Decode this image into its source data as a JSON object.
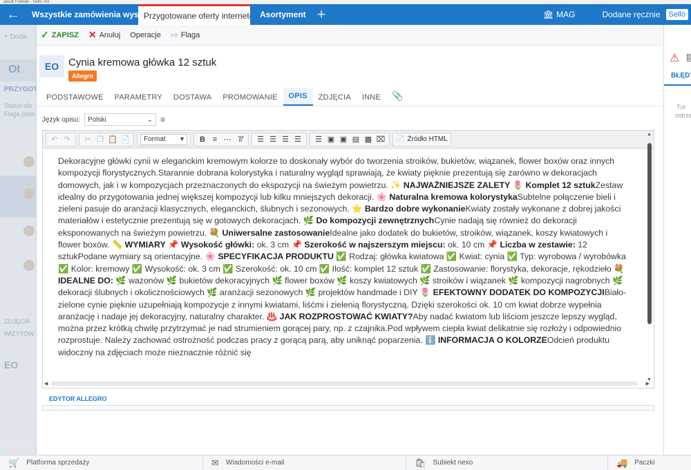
{
  "window": {
    "title": "Jakub Fulwiak - Sello Tex"
  },
  "topbar": {
    "tabs": [
      {
        "label": "Wszystkie zamówienia wysyłk"
      },
      {
        "label": "Przygotowane oferty internetowe"
      },
      {
        "label": "Asortyment"
      }
    ],
    "mag_label": "MAG",
    "user_label": "Dodane ręcznie",
    "sello_badge": "Sello"
  },
  "background_list": {
    "add_label": "Doda",
    "oi_label": "OI",
    "section_label": "PRZYGOT",
    "status_label": "Status ofe",
    "flag_label": "Flaga (dow",
    "zdjecia_label": "ZDJĘCIA",
    "wzytowe_label": "WIZYTÓW",
    "eo_label": "EO"
  },
  "toolbar": {
    "save_label": "ZAPISZ",
    "cancel_label": "Anuluj",
    "operations_label": "Operacje",
    "flag_label": "Flaga"
  },
  "product": {
    "avatar": "EO",
    "title": "Cynia kremowa główka 12 sztuk",
    "badge": "Allegro"
  },
  "nav_tabs": [
    {
      "label": "PODSTAWOWE"
    },
    {
      "label": "PARAMETRY"
    },
    {
      "label": "DOSTAWA"
    },
    {
      "label": "PROMOWANIE"
    },
    {
      "label": "OPIS"
    },
    {
      "label": "ZDJĘCIA"
    },
    {
      "label": "INNE"
    }
  ],
  "lang": {
    "label": "Język opisu:",
    "value": "Polski"
  },
  "rte": {
    "format_label": "Format",
    "source_label": "Źródło HTML",
    "editor_label": "EDYTOR ALLEGRO"
  },
  "description": {
    "p1": "Dekoracyjne główki cynii w eleganckim kremowym kolorze to doskonały wybór do tworzenia stroików, bukietów, wiązanek, flower boxów oraz innych kompozycji florystycznych.Starannie dobrana kolorystyka i naturalny wygląd sprawiają, że kwiaty pięknie prezentują się zarówno w dekoracjach domowych, jak i w kompozycjach przeznaczonych do ekspozycji na świeżym powietrzu.",
    "h_zalety": "NAJWAŻNIEJSZE ZALETY",
    "h_komplet": "Komplet 12 sztuk",
    "t_komplet": "Zestaw idealny do przygotowania jednej większej kompozycji lub kilku mniejszych dekoracji.",
    "h_naturalna": "Naturalna kremowa kolorystyka",
    "t_naturalna": "Subtelne połączenie bieli i zieleni pasuje do aranżacji klasycznych, eleganckich, ślubnych i sezonowych.",
    "h_wykonanie": "Bardzo dobre wykonanie",
    "t_wykonanie": "Kwiaty zostały wykonane z dobrej jakości materiałów i estetycznie prezentują się w gotowych dekoracjach.",
    "h_zewn": "Do kompozycji zewnętrznych",
    "t_zewn": "Cynie nadają się również do dekoracji eksponowanych na świeżym powietrzu.",
    "h_uniw": "Uniwersalne zastosowanie",
    "t_uniw": "Idealne jako dodatek do bukietów, stroików, wiązanek, koszy kwiatowych i flower boxów.",
    "h_wymiary": "WYMIARY",
    "h_wys": "Wysokość główki:",
    "t_wys": " ok. 3 cm",
    "h_szer": "Szerokość w najszerszym miejscu:",
    "t_szer": " ok. 10 cm",
    "h_liczba": "Liczba w zestawie:",
    "t_liczba": " 12 sztuk",
    "t_podane": "Podane wymiary są orientacyjne.",
    "h_spec": "SPECYFIKACJA PRODUKTU",
    "spec_items": " Rodzaj: główka kwiatowa ✅ Kwiat: cynia ✅ Typ: wyrobowa / wyrobówka ✅ Kolor: kremowy ✅ Wysokość: ok. 3 cm ✅ Szerokość: ok. 10 cm ✅ Ilość: komplet 12 sztuk ✅ Zastosowanie: florystyka, dekoracje, rękodzieło",
    "h_idealne": "IDEALNE DO:",
    "idealne_items": " 🌿 wazonów 🌿 bukietów dekoracyjnych 🌿 flower boxów 🌿 koszy kwiatowych 🌿 stroików i wiązanek 🌿 kompozycji nagrobnych 🌿 dekoracji ślubnych i okolicznościowych 🌿 aranżacji sezonowych 🌿 projektów handmade i DIY",
    "h_efekt": "EFEKTOWNY DODATEK DO KOMPOZYCJI",
    "t_efekt": "Biało-zielone cynie pięknie uzupełniają kompozycje z innymi kwiatami, liśćmi i zielenią florystyczną. Dzięki szerokości ok. 10 cm kwiat dobrze wypełnia aranżację i nadaje jej dekoracyjny, naturalny charakter.",
    "h_jak": "JAK ROZPROSTOWAĆ KWIATY?",
    "t_jak": "Aby nadać kwiatom lub liściom jeszcze lepszy wygląd, można przez krótką chwilę przytrzymać je nad strumieniem gorącej pary, np. z czajnika.Pod wpływem ciepła kwiat delikatnie się rozłoży i odpowiednio rozprostuje. Należy zachować ostrożność podczas pracy z gorącą parą, aby uniknąć poparzenia.",
    "h_info": "INFORMACJA O KOLORZE",
    "t_info": "Odcień produktu widoczny na zdjęciach może nieznacznie różnić się"
  },
  "right_panel": {
    "tab_label": "BŁĘDY",
    "text1": "Tut",
    "text2": "ostrze"
  },
  "bottombar": {
    "items": [
      {
        "label": "Platforma sprzedaży"
      },
      {
        "label": "Wiadomości e-mail"
      },
      {
        "label": "Subiekt nexo"
      },
      {
        "label": "Paczki"
      }
    ]
  }
}
